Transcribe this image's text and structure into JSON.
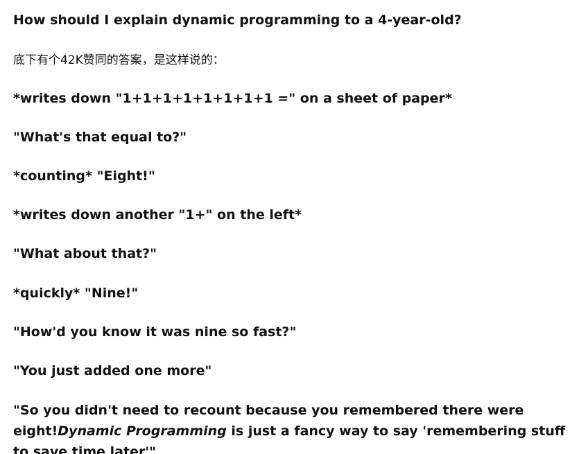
{
  "article": {
    "title": "How should I explain dynamic programming to a 4-year-old?",
    "intro": "底下有个42K赞同的答案，是这样说的：",
    "lines": [
      "*writes down \"1+1+1+1+1+1+1+1 =\" on a sheet of paper*",
      "\"What's that equal to?\"",
      "*counting* \"Eight!\"",
      "*writes down another \"1+\" on the left*",
      "\"What about that?\"",
      "*quickly* \"Nine!\"",
      "\"How'd you know it was nine so fast?\"",
      "\"You just added one more\""
    ],
    "final": {
      "part1": "\"So you didn't need to recount because you remembered there were eight!",
      "emphasis": "Dynamic Programming",
      "part2": " is just a fancy way to say 'remembering stuff to save time later'\""
    }
  }
}
